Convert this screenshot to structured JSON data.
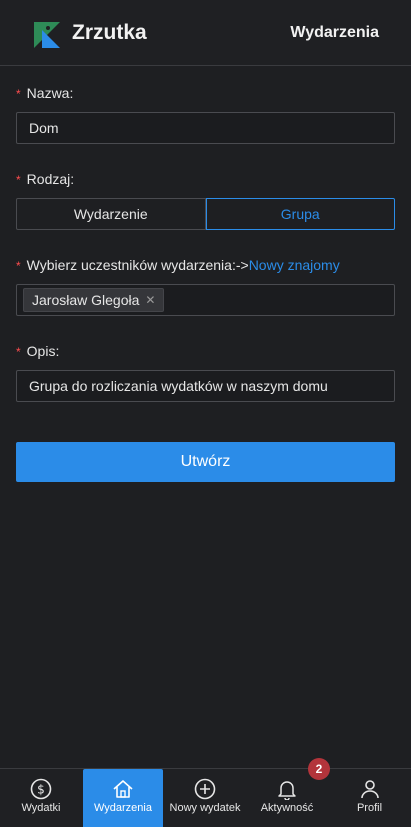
{
  "header": {
    "brand": "Zrzutka",
    "nav_link": "Wydarzenia"
  },
  "form": {
    "name": {
      "label": "Nazwa:",
      "value": "Dom"
    },
    "type": {
      "label": "Rodzaj:",
      "options": [
        "Wydarzenie",
        "Grupa"
      ],
      "selected": "Grupa"
    },
    "participants": {
      "label": "Wybierz uczestników wydarzenia:->",
      "link": "Nowy znajomy",
      "tags": [
        "Jarosław Glegoła"
      ]
    },
    "description": {
      "label": "Opis:",
      "value": "Grupa do rozliczania wydatków w naszym domu"
    },
    "submit_label": "Utwórz"
  },
  "bottom_nav": {
    "items": [
      {
        "label": "Wydatki",
        "icon": "dollar-circle-icon"
      },
      {
        "label": "Wydarzenia",
        "icon": "home-icon"
      },
      {
        "label": "Nowy wydatek",
        "icon": "plus-circle-icon"
      },
      {
        "label": "Aktywność",
        "icon": "bell-icon"
      },
      {
        "label": "Profil",
        "icon": "user-icon"
      }
    ],
    "active": "Wydarzenia",
    "notification_count": "2"
  },
  "colors": {
    "accent": "#2b8ce8",
    "background": "#1e1f22",
    "required": "#ff4d4f",
    "badge": "#b3343b"
  }
}
